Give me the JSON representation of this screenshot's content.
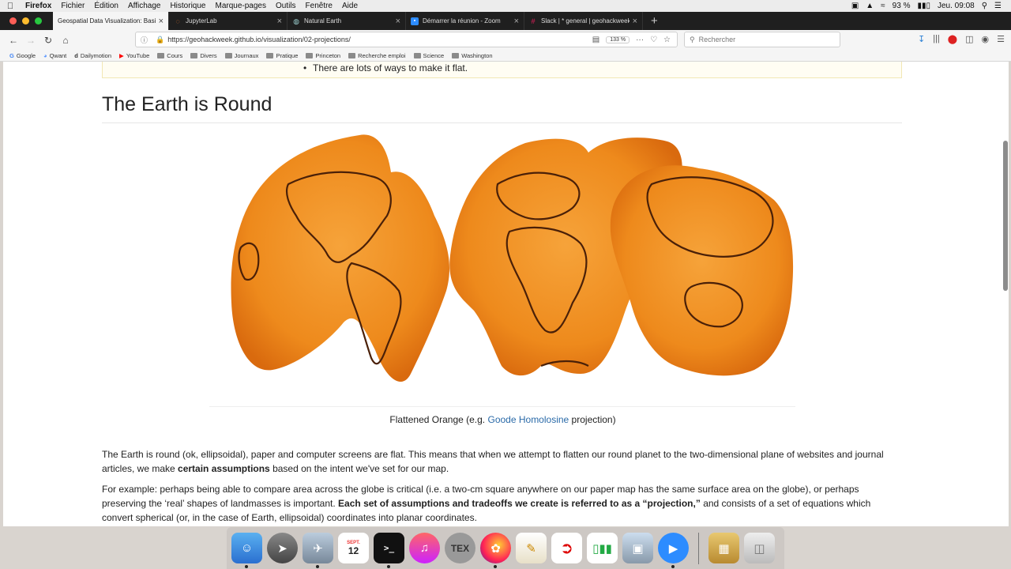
{
  "menubar": {
    "app": "Firefox",
    "items": [
      "Fichier",
      "Édition",
      "Affichage",
      "Historique",
      "Marque-pages",
      "Outils",
      "Fenêtre",
      "Aide"
    ],
    "battery": "93 %",
    "clock": "Jeu. 09:08"
  },
  "tabs": [
    {
      "title": "Geospatial Data Visualization: Basics",
      "active": true
    },
    {
      "title": "JupyterLab",
      "active": false
    },
    {
      "title": "Natural Earth",
      "active": false
    },
    {
      "title": "Démarrer la réunion - Zoom",
      "active": false
    },
    {
      "title": "Slack | * general | geohackweek",
      "active": false
    }
  ],
  "navbar": {
    "url": "https://geohackweek.github.io/visualization/02-projections/",
    "zoom": "133 %",
    "search_placeholder": "Rechercher"
  },
  "bookmarks": [
    "Google",
    "Qwant",
    "Dailymotion",
    "YouTube",
    "Cours",
    "Divers",
    "Journaux",
    "Pratique",
    "Princeton",
    "Recherche emploi",
    "Science",
    "Washington"
  ],
  "page": {
    "callout_item": "There are lots of ways to make it flat.",
    "heading": "The Earth is Round",
    "caption_prefix": "Flattened Orange (e.g. ",
    "caption_link": "Goode Homolosine",
    "caption_suffix": " projection)",
    "p1_a": "The Earth is round (ok, ellipsoidal), paper and computer screens are flat. This means that when we attempt to flatten our round planet to the two-dimensional plane of websites and journal articles, we make ",
    "p1_bold": "certain assumptions",
    "p1_b": " based on the intent we've set for our map.",
    "p2_a": "For example: perhaps being able to compare area across the globe is critical (i.e. a two-cm square anywhere on our paper map has the same surface area on the globe), or perhaps preserving the ‘real’ shapes of landmasses is important. ",
    "p2_bold": "Each set of assumptions and tradeoffs we create is referred to as a “projection,”",
    "p2_b": " and consists of a set of equations which convert spherical (or, in the case of Earth, ellipsoidal) coordinates into planar coordinates."
  },
  "dock": {
    "calendar_month": "SEPT.",
    "calendar_day": "12",
    "tex_label": "TEX"
  },
  "colors": {
    "orange": "#f08c1e",
    "orange_dark": "#d86a10",
    "link": "#2a6aa8",
    "tab_bar": "#1f1f1f"
  }
}
